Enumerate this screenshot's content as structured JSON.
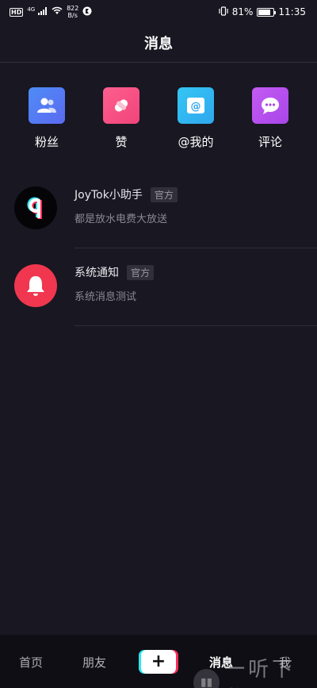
{
  "status_bar": {
    "hd": "HD",
    "net_type": "4G",
    "net_speed_value": "822",
    "net_speed_unit": "B/s",
    "battery_percent": "81%",
    "battery_level": 0.81,
    "time": "11:35"
  },
  "header": {
    "title": "消息"
  },
  "categories": [
    {
      "label": "粉丝",
      "icon": "fans-icon",
      "color_from": "#4e8cf7",
      "color_to": "#5b6af0"
    },
    {
      "label": "赞",
      "icon": "heart-icon",
      "color_from": "#ff5f8f",
      "color_to": "#f0447a"
    },
    {
      "label": "@我的",
      "icon": "at-icon",
      "color_from": "#35c6f4",
      "color_to": "#2fa7ee"
    },
    {
      "label": "评论",
      "icon": "comment-icon",
      "color_from": "#c35bf2",
      "color_to": "#a946ea"
    }
  ],
  "messages": [
    {
      "title": "JoyTok小助手",
      "badge": "官方",
      "preview": "都是放水电费大放送",
      "avatar_icon": "joytok-logo-icon"
    },
    {
      "title": "系统通知",
      "badge": "官方",
      "preview": "系统消息测试",
      "avatar_icon": "bell-icon"
    }
  ],
  "bottom_nav": {
    "home": "首页",
    "friends": "朋友",
    "plus": "+",
    "messages": "消息",
    "me": "我"
  },
  "watermark": {
    "text": "一听下载"
  },
  "colors": {
    "background": "#181722",
    "nav_background": "#0f0e15",
    "bell_red": "#f0374f",
    "accent_cyan": "#2ce6ee",
    "accent_pink": "#ff2c56"
  }
}
